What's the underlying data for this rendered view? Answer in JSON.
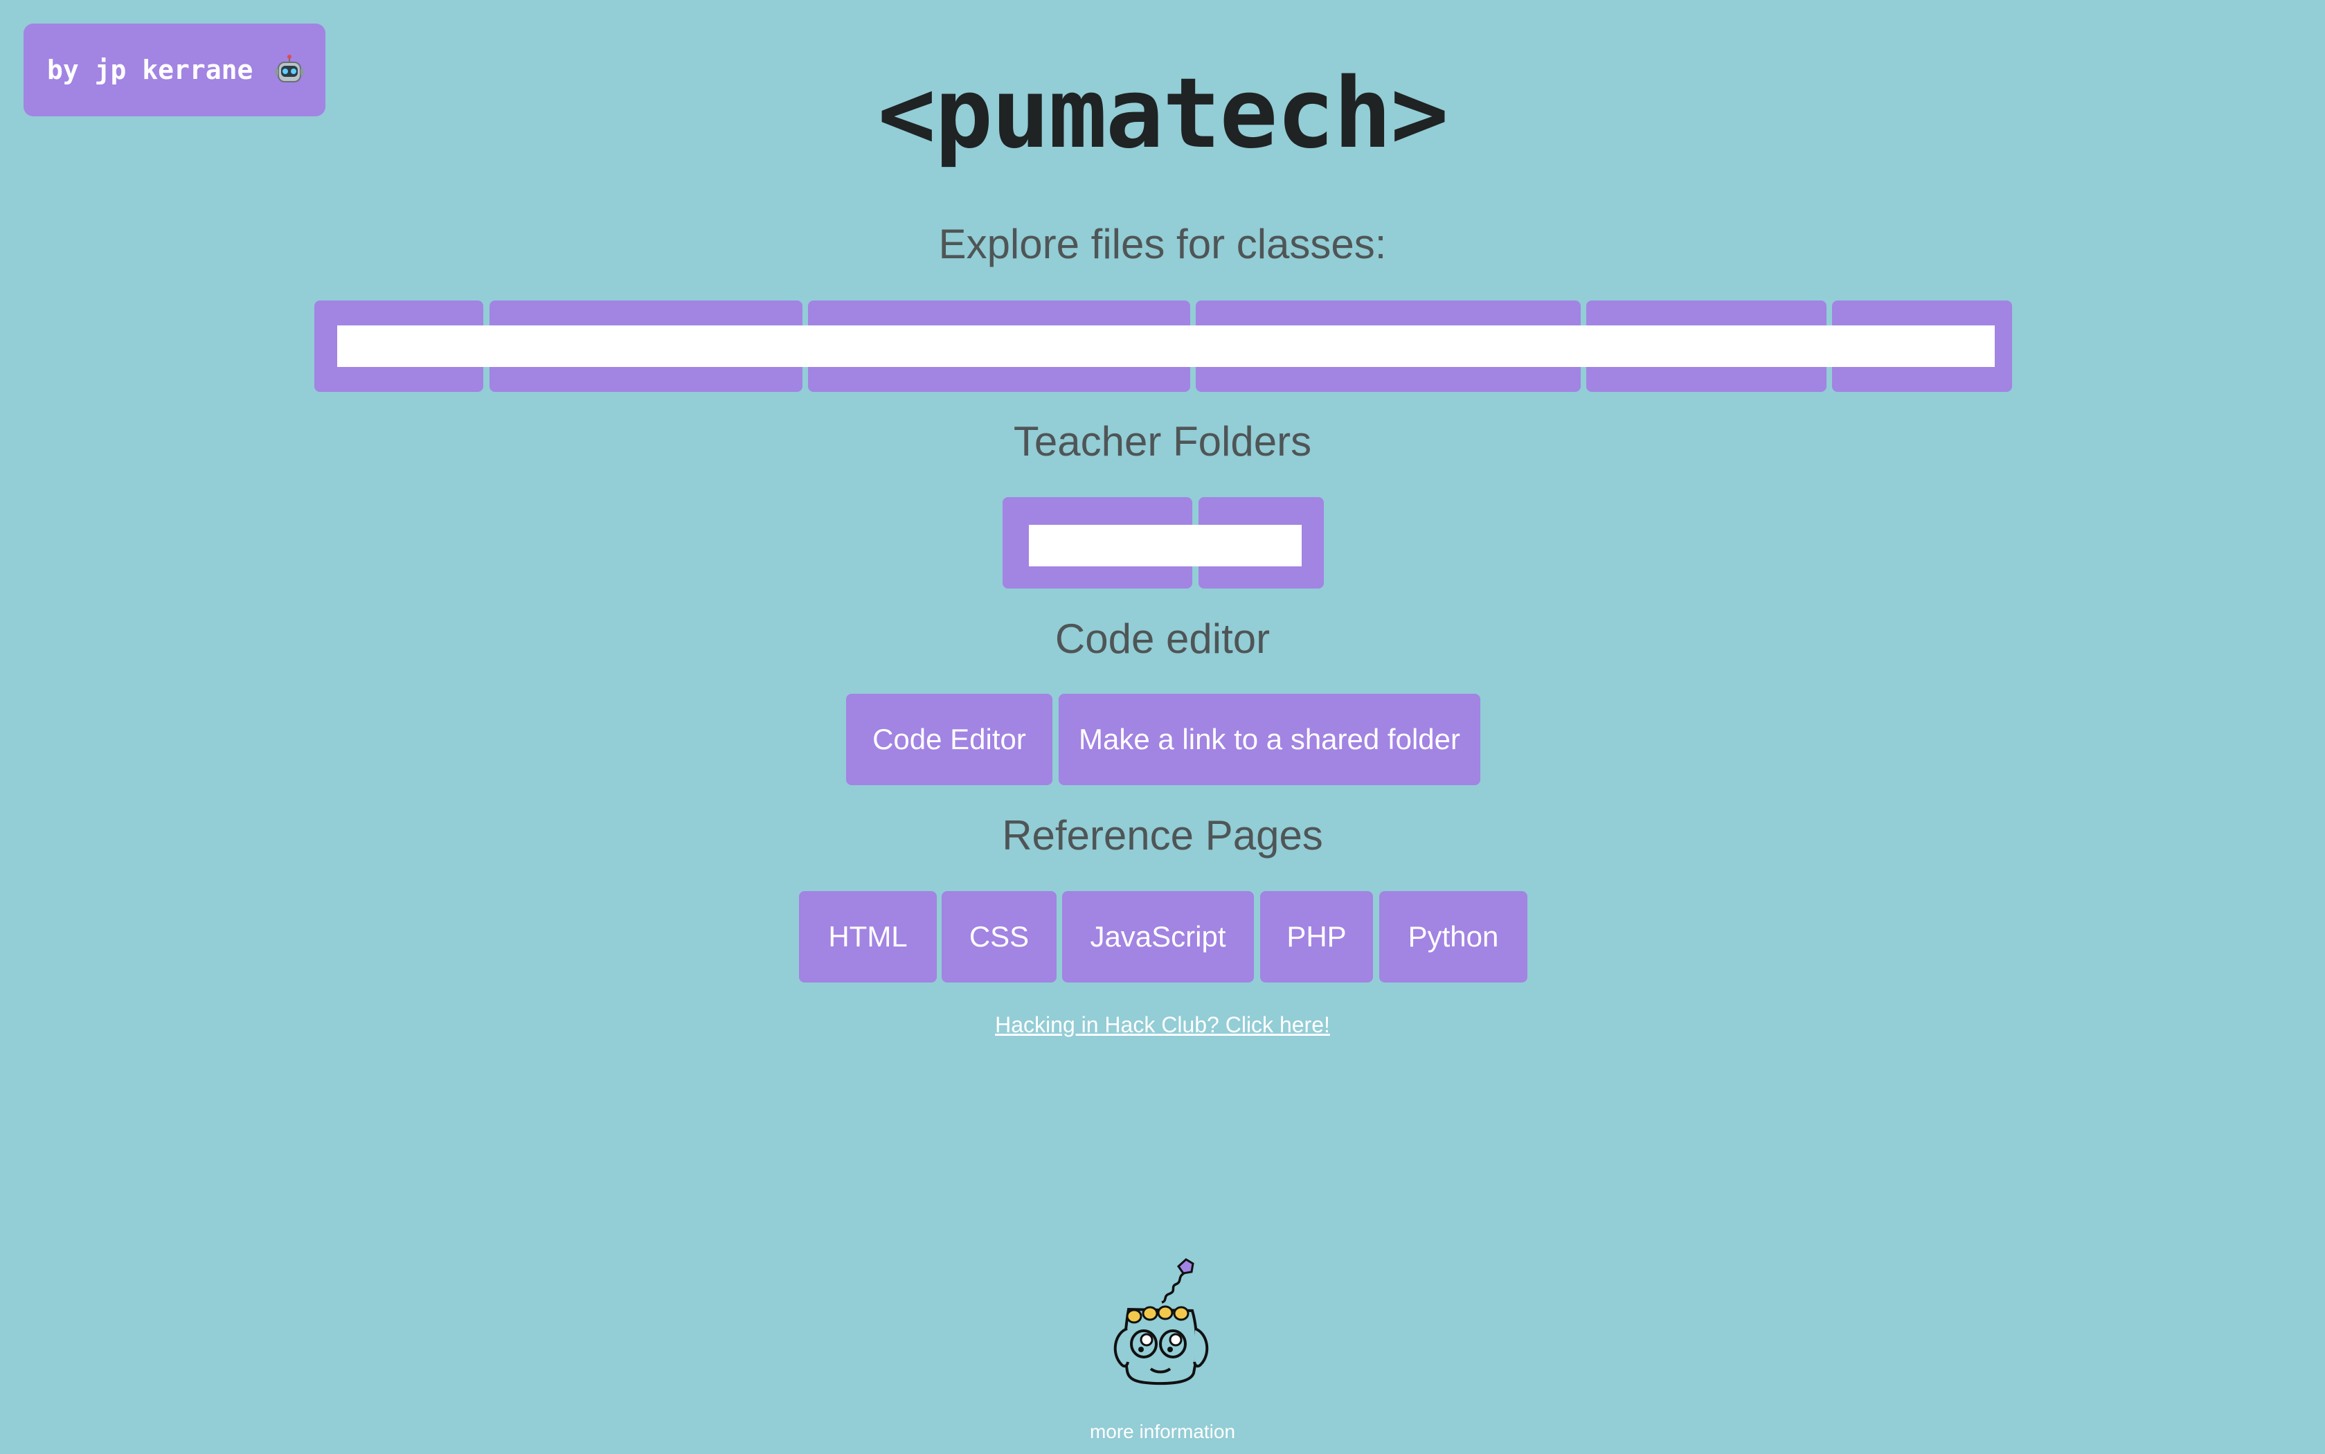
{
  "author_badge": {
    "label": "by jp kerrane",
    "icon": "robot-icon"
  },
  "title": "<pumatech>",
  "sections": {
    "classes_heading": "Explore files for classes:",
    "teacher_heading": "Teacher Folders",
    "editor_heading": "Code editor",
    "reference_heading": "Reference Pages"
  },
  "class_buttons": [
    "",
    "",
    "",
    "",
    "",
    ""
  ],
  "teacher_buttons": [
    "",
    ""
  ],
  "editor_buttons": [
    "Code Editor",
    "Make a link to a shared folder"
  ],
  "reference_buttons": [
    "HTML",
    "CSS",
    "JavaScript",
    "PHP",
    "Python"
  ],
  "hack_club_link": "Hacking in Hack Club? Click here!",
  "footer": {
    "more_info": "more information",
    "mascot_icon": "robot-mascot-icon"
  },
  "colors": {
    "background": "#93cdd6",
    "accent": "#a284e3",
    "title": "#1f2324",
    "heading": "#4f5556"
  }
}
